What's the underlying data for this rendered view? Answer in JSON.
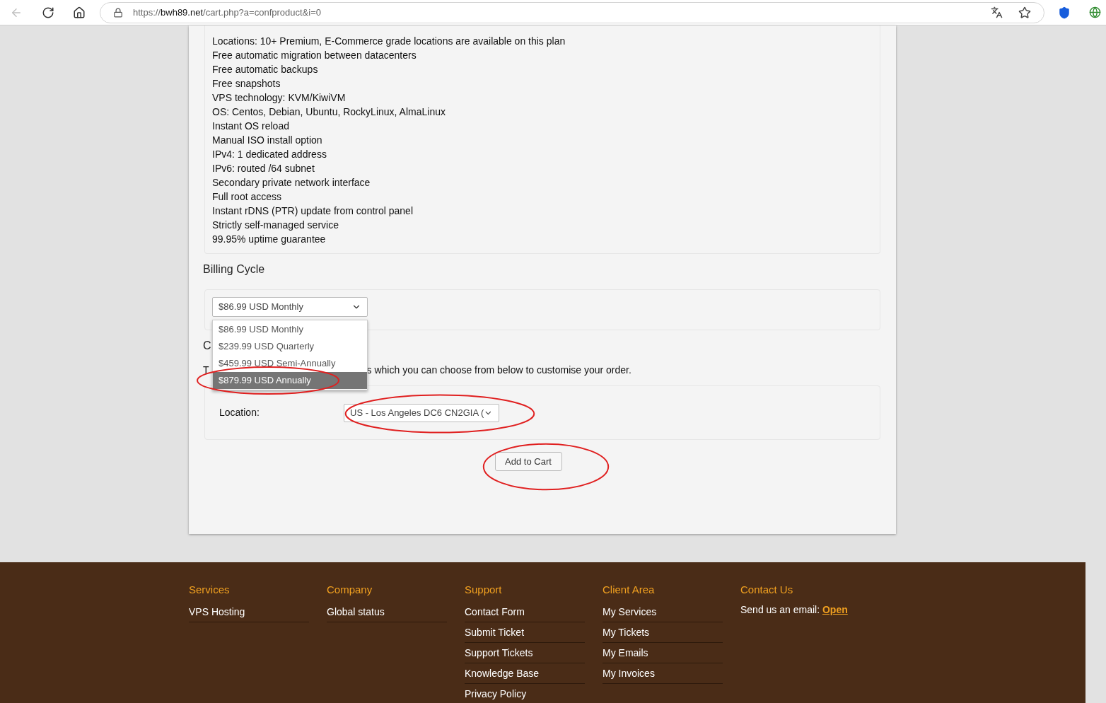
{
  "browser": {
    "url_scheme": "https://",
    "url_domain": "bwh89.net",
    "url_path": "/cart.php?a=confproduct&i=0"
  },
  "features": [
    "Locations: 10+ Premium, E-Commerce grade locations are available on this plan",
    "Free automatic migration between datacenters",
    "Free automatic backups",
    "Free snapshots",
    "VPS technology: KVM/KiwiVM",
    "OS: Centos, Debian, Ubuntu, RockyLinux, AlmaLinux",
    "Instant OS reload",
    "Manual ISO install option",
    "IPv4: 1 dedicated address",
    "IPv6: routed /64 subnet",
    "Secondary private network interface",
    "Full root access",
    "Instant rDNS (PTR) update from control panel",
    "Strictly self-managed service",
    "99.95% uptime guarantee"
  ],
  "billing": {
    "heading": "Billing Cycle",
    "value": "$86.99 USD Monthly",
    "options": [
      {
        "label": "$86.99 USD Monthly",
        "highlighted": false,
        "circled": false
      },
      {
        "label": "$239.99 USD Quarterly",
        "highlighted": false,
        "circled": false
      },
      {
        "label": "$459.99 USD Semi-Annually",
        "highlighted": false,
        "circled": false
      },
      {
        "label": "$879.99 USD Annually",
        "highlighted": true,
        "circled": true
      }
    ]
  },
  "config": {
    "heading": "C",
    "intro_start": "T",
    "intro_end": "s which you can choose from below to customise your order.",
    "location_label": "Location:",
    "location_value": "US - Los Angeles DC6 CN2GIA (",
    "location_circled": true
  },
  "add_to_cart": {
    "label": "Add to Cart",
    "circled": true
  },
  "footer": {
    "columns": [
      {
        "title": "Services",
        "links": [
          "VPS Hosting"
        ]
      },
      {
        "title": "Company",
        "links": [
          "Global status"
        ]
      },
      {
        "title": "Support",
        "links": [
          "Contact Form",
          "Submit Ticket",
          "Support Tickets",
          "Knowledge Base",
          "Privacy Policy"
        ]
      },
      {
        "title": "Client Area",
        "links": [
          "My Services",
          "My Tickets",
          "My Emails",
          "My Invoices"
        ]
      }
    ],
    "contact": {
      "title": "Contact Us",
      "text": "Send us an email:",
      "link": "Open"
    }
  }
}
